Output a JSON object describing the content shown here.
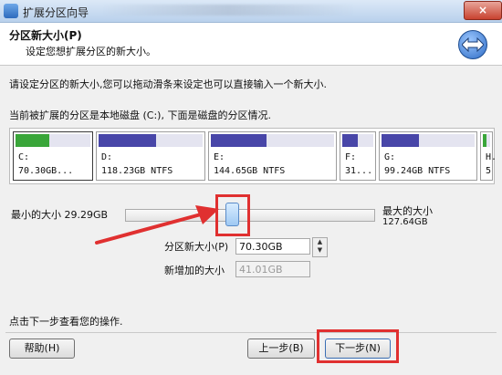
{
  "window": {
    "title": "扩展分区向导",
    "close_label": "×"
  },
  "header": {
    "title": "分区新大小(P)",
    "subtitle": "设定您想扩展分区的新大小。"
  },
  "body": {
    "desc1": "请设定分区的新大小,您可以拖动滑条来设定也可以直接输入一个新大小.",
    "desc2": "当前被扩展的分区是本地磁盘 (C:), 下面是磁盘的分区情况."
  },
  "partitions": [
    {
      "letter": "C:",
      "info": "70.30GB...",
      "used_fraction": 0.45,
      "color": "#3aa63a",
      "selected": true
    },
    {
      "letter": "D:",
      "info": "118.23GB NTFS",
      "used_fraction": 0.55,
      "color": "#4846a8",
      "selected": false
    },
    {
      "letter": "E:",
      "info": "144.65GB NTFS",
      "used_fraction": 0.45,
      "color": "#4846a8",
      "selected": false
    },
    {
      "letter": "F:",
      "info": "31...",
      "used_fraction": 0.5,
      "color": "#4846a8",
      "selected": false
    },
    {
      "letter": "G:",
      "info": "99.24GB NTFS",
      "used_fraction": 0.4,
      "color": "#4846a8",
      "selected": false
    },
    {
      "letter": "H.",
      "info": "5",
      "used_fraction": 0.5,
      "color": "#3aa63a",
      "selected": false
    }
  ],
  "slider": {
    "min_label": "最小的大小 29.29GB",
    "max_label": "最大的大小",
    "max_value": "127.64GB",
    "position_fraction": 0.42
  },
  "fields": {
    "new_size_label": "分区新大小(P)",
    "new_size_value": "70.30GB",
    "added_label": "新增加的大小",
    "added_value": "41.01GB",
    "spin_up": "▲",
    "spin_down": "▼"
  },
  "footer": {
    "hint": "点击下一步查看您的操作.",
    "help": "帮助(H)",
    "back": "上一步(B)",
    "next": "下一步(N)"
  },
  "colors": {
    "highlight": "#e03030",
    "arrow": "#e03030"
  }
}
